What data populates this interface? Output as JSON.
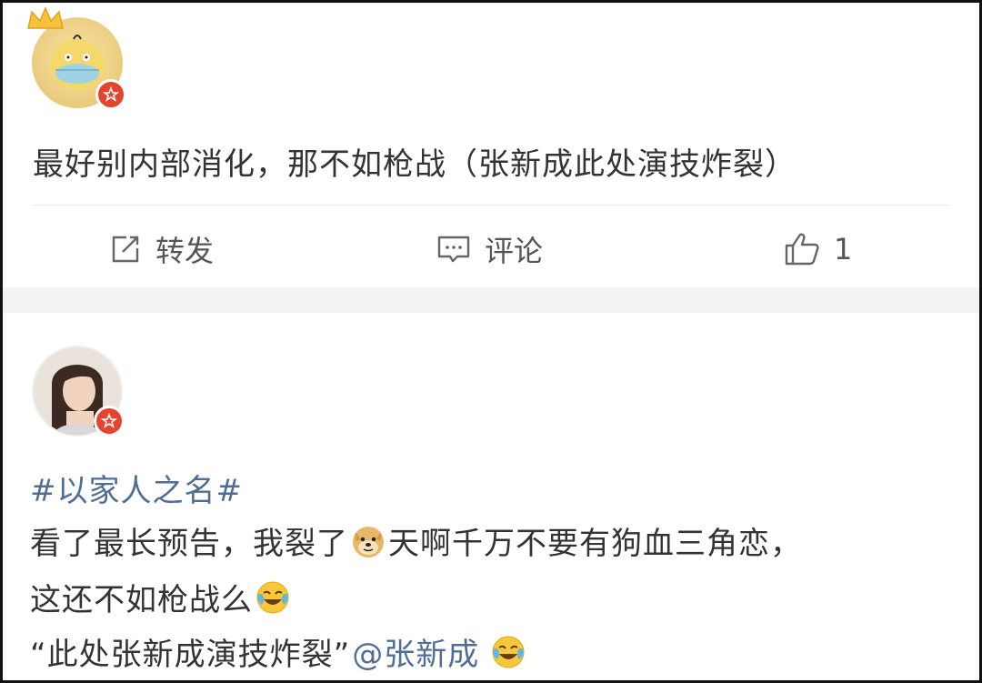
{
  "post1": {
    "text": "最好别内部消化，那不如枪战（张新成此处演技炸裂）",
    "actions": {
      "repost_label": "转发",
      "comment_label": "评论",
      "like_count": "1"
    }
  },
  "post2": {
    "hashtag": "#以家人之名#",
    "line1_a": "看了最长预告，我裂了",
    "line1_b": "天啊千万不要有狗血三角恋，",
    "line2": "这还不如枪战么",
    "line3_quote": "“此处张新成演技炸裂”",
    "line3_mention": "@张新成"
  },
  "colors": {
    "link": "#4f6d95",
    "badge": "#e4432c",
    "text": "#333333"
  },
  "icons": [
    "crown-icon",
    "verified-badge-icon",
    "repost-icon",
    "comment-icon",
    "like-icon",
    "doge-emoji",
    "laugh-cry-emoji"
  ]
}
